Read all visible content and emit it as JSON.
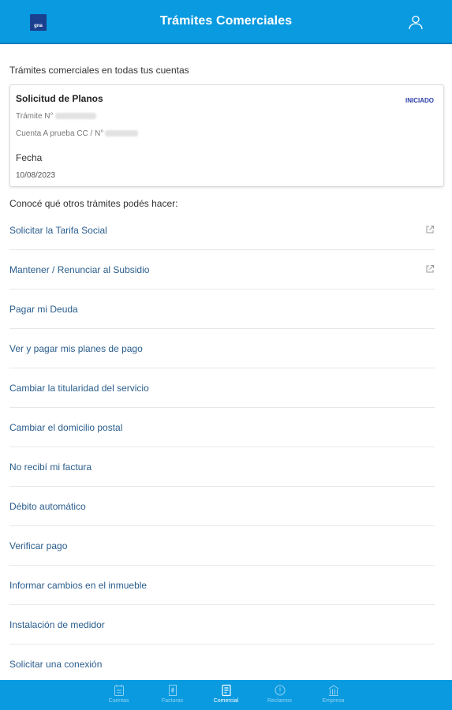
{
  "header": {
    "logo_text": "gna",
    "title": "Trámites Comerciales",
    "user_icon": "user-icon"
  },
  "section_title": "Trámites comerciales en todas tus cuentas",
  "card": {
    "title": "Solicitud de Planos",
    "status": "INICIADO",
    "tramite_label": "Trámite N°",
    "cuenta_label": "Cuenta A prueba CC / N°",
    "fecha_label": "Fecha",
    "fecha_value": "10/08/2023"
  },
  "others_title": "Conocé qué otros trámites podés hacer:",
  "items": [
    {
      "label": "Solicitar la Tarifa Social",
      "external": true
    },
    {
      "label": "Mantener / Renunciar al Subsidio",
      "external": true
    },
    {
      "label": "Pagar mi Deuda",
      "external": false
    },
    {
      "label": "Ver y pagar mis planes de pago",
      "external": false
    },
    {
      "label": "Cambiar la titularidad del servicio",
      "external": false
    },
    {
      "label": "Cambiar el domicilio postal",
      "external": false
    },
    {
      "label": "No recibí mi factura",
      "external": false
    },
    {
      "label": "Débito automático",
      "external": false
    },
    {
      "label": "Verificar pago",
      "external": false
    },
    {
      "label": "Informar cambios en el inmueble",
      "external": false
    },
    {
      "label": "Instalación de medidor",
      "external": false
    },
    {
      "label": "Solicitar una conexión",
      "external": false
    }
  ],
  "nav": [
    {
      "label": "Cuentas",
      "icon": "accounts-icon",
      "active": false
    },
    {
      "label": "Facturas",
      "icon": "invoice-icon",
      "active": false
    },
    {
      "label": "Comercial",
      "icon": "commercial-icon",
      "active": true
    },
    {
      "label": "Reclamos",
      "icon": "claims-icon",
      "active": false
    },
    {
      "label": "Empresa",
      "icon": "company-icon",
      "active": false
    }
  ],
  "colors": {
    "primary": "#0a9ae0",
    "link": "#2a5d8c",
    "status": "#2b3ea8"
  }
}
